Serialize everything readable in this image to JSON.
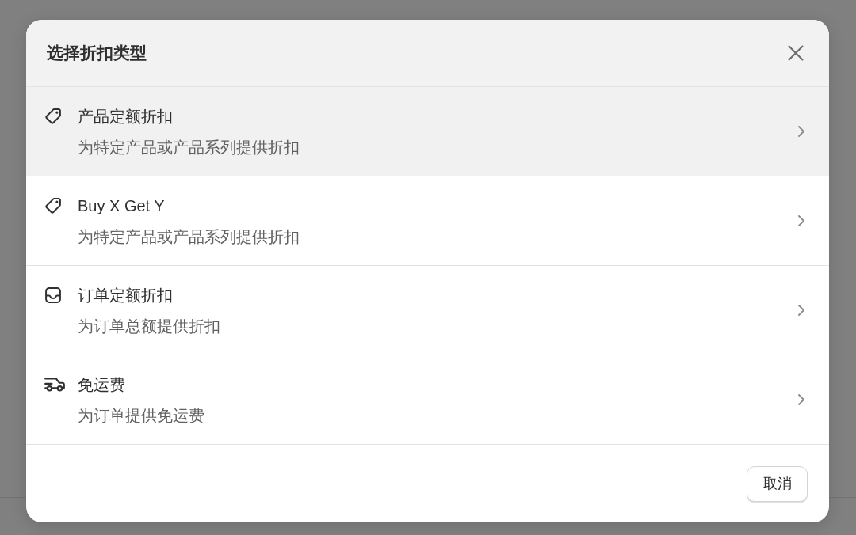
{
  "dialog": {
    "title": "选择折扣类型"
  },
  "options": [
    {
      "kind": "product",
      "title": "产品定额折扣",
      "description": "为特定产品或产品系列提供折扣",
      "selected": true
    },
    {
      "kind": "bxgy",
      "title": "Buy X Get Y",
      "description": "为特定产品或产品系列提供折扣",
      "selected": false
    },
    {
      "kind": "order",
      "title": "订单定额折扣",
      "description": "为订单总额提供折扣",
      "selected": false
    },
    {
      "kind": "shipping",
      "title": "免运费",
      "description": "为订单提供免运费",
      "selected": false
    }
  ],
  "footer": {
    "cancel_button": "取消"
  }
}
